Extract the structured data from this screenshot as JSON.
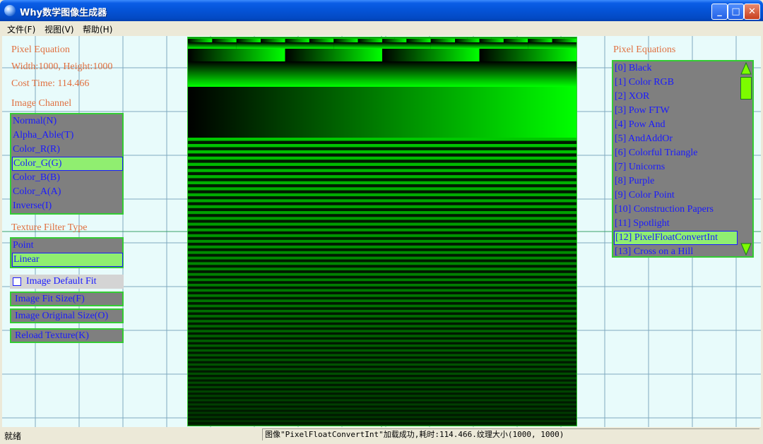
{
  "window": {
    "title": "Why数学图像生成器",
    "minimize_glyph": "_",
    "maximize_glyph": "□",
    "close_glyph": "✕"
  },
  "menu": [
    "文件(F)",
    "视图(V)",
    "帮助(H)"
  ],
  "info": {
    "heading": "Pixel Equation",
    "size": "Width:1000, Height:1000",
    "cost": "Cost Time: 114.466"
  },
  "channel": {
    "heading": "Image Channel",
    "items": [
      "Normal(N)",
      "Alpha_Able(T)",
      "Color_R(R)",
      "Color_G(G)",
      "Color_B(B)",
      "Color_A(A)",
      "Inverse(I)"
    ],
    "selected": "Color_G(G)"
  },
  "filter": {
    "heading": "Texture Filter Type",
    "items": [
      "Point",
      "Linear"
    ],
    "selected": "Linear"
  },
  "controls": {
    "default_fit_label": "Image Default Fit",
    "default_fit_checked": false,
    "fit_size_label": "Image Fit Size(F)",
    "original_size_label": "Image Original Size(O)",
    "reload_label": "Reload Texture(K)"
  },
  "equations": {
    "heading": "Pixel Equations",
    "items": [
      "[0] Black",
      "[1] Color RGB",
      "[2] XOR",
      "[3] Pow FTW",
      "[4] Pow And",
      "[5] AndAddOr",
      "[6] Colorful Triangle",
      "[7] Unicorns",
      "[8] Purple",
      "[9] Color Point",
      "[10] Construction Papers",
      "[11] Spotlight",
      "[12] PixelFloatConvertInt",
      "[13] Cross on a Hill"
    ],
    "selected": "[12] PixelFloatConvertInt"
  },
  "status": {
    "ready": "就绪",
    "message": "图像\"PixelFloatConvertInt\"加载成功,耗时:114.466.纹理大小(1000, 1000)"
  },
  "colors": {
    "accent_green": "#33cc33",
    "selection": "#90ee70",
    "list_bg": "#7f7f7f",
    "list_text": "#1a1aff",
    "label_orange": "#e07040",
    "client_bg": "#e8fbfb"
  }
}
